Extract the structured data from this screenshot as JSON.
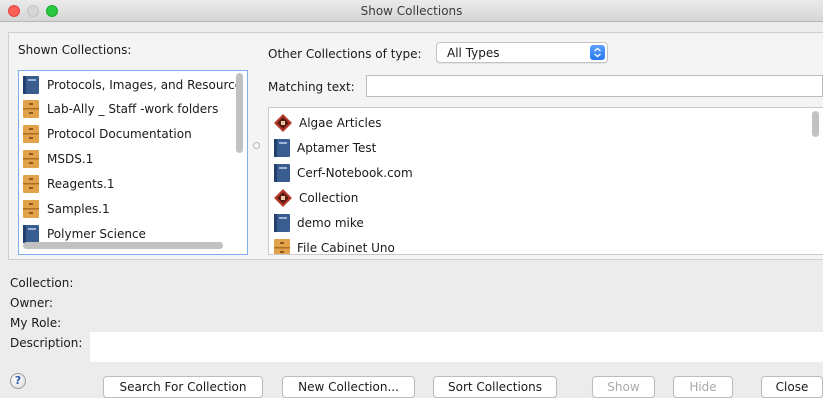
{
  "window": {
    "title": "Show Collections"
  },
  "shown": {
    "label": "Shown Collections:",
    "items": [
      {
        "label": "Protocols, Images, and Resource",
        "icon": "notebook-icon"
      },
      {
        "label": "Lab-Ally _ Staff -work folders",
        "icon": "file-cabinet-icon"
      },
      {
        "label": "Protocol Documentation",
        "icon": "file-cabinet-icon"
      },
      {
        "label": "MSDS.1",
        "icon": "file-cabinet-icon"
      },
      {
        "label": "Reagents.1",
        "icon": "file-cabinet-icon"
      },
      {
        "label": "Samples.1",
        "icon": "file-cabinet-icon"
      },
      {
        "label": "Polymer Science",
        "icon": "notebook-icon"
      }
    ]
  },
  "other": {
    "type_label": "Other Collections of type:",
    "type_value": "All Types",
    "match_label": "Matching text:",
    "match_value": "",
    "items": [
      {
        "label": "Algae Articles",
        "icon": "library-icon"
      },
      {
        "label": "Aptamer Test",
        "icon": "notebook-icon"
      },
      {
        "label": "Cerf-Notebook.com",
        "icon": "notebook-icon"
      },
      {
        "label": "Collection",
        "icon": "library-icon"
      },
      {
        "label": "demo mike",
        "icon": "notebook-icon"
      },
      {
        "label": "File Cabinet Uno",
        "icon": "file-cabinet-icon"
      }
    ]
  },
  "info": {
    "collection_label": "Collection:",
    "owner_label": "Owner:",
    "role_label": "My Role:",
    "description_label": "Description:"
  },
  "buttons": {
    "help_glyph": "?",
    "search": "Search For Collection",
    "new": "New Collection...",
    "sort": "Sort Collections",
    "show": "Show",
    "hide": "Hide",
    "close": "Close"
  },
  "colors": {
    "accent": "#2a78f0",
    "selection_border": "#7eaef0",
    "notebook_blue": "#3a5d8f",
    "cabinet_orange": "#e2a24a",
    "library_red": "#b83a2a",
    "disabled_text": "#a9a9a9"
  }
}
